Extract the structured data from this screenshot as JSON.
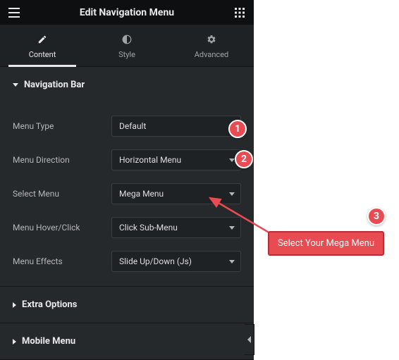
{
  "header": {
    "title": "Edit Navigation Menu"
  },
  "tabs": {
    "content": "Content",
    "style": "Style",
    "advanced": "Advanced"
  },
  "sections": {
    "navbar": {
      "title": "Navigation Bar",
      "fields": {
        "menu_type": {
          "label": "Menu Type",
          "value": "Default"
        },
        "menu_direction": {
          "label": "Menu Direction",
          "value": "Horizontal Menu"
        },
        "select_menu": {
          "label": "Select Menu",
          "value": "Mega Menu"
        },
        "hover_click": {
          "label": "Menu Hover/Click",
          "value": "Click Sub-Menu"
        },
        "effects": {
          "label": "Menu Effects",
          "value": "Slide Up/Down (Js)"
        }
      }
    },
    "extra": {
      "title": "Extra Options"
    },
    "mobile": {
      "title": "Mobile Menu"
    }
  },
  "annotations": {
    "b1": "1",
    "b2": "2",
    "b3": "3",
    "callout": "Select Your Mega Menu"
  }
}
